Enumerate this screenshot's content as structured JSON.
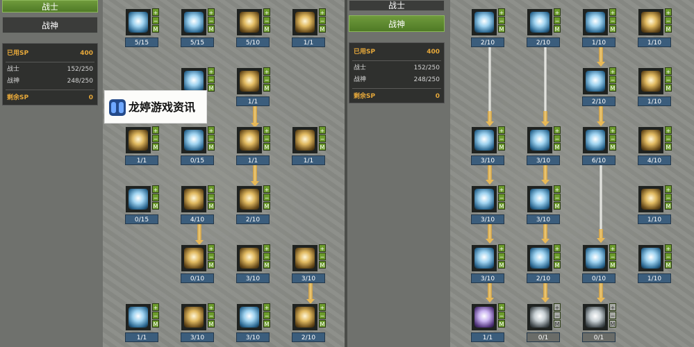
{
  "left": {
    "tab_warrior": "战士",
    "tab_wargod": "战神",
    "sp": {
      "used_label": "已用SP",
      "used_value": "400",
      "class1_label": "战士",
      "class1_value": "152/250",
      "class2_label": "战神",
      "class2_value": "248/250",
      "remain_label": "剩余SP",
      "remain_value": "0"
    },
    "skills": [
      {
        "level": "5/15",
        "icon": "blue"
      },
      {
        "level": "5/15",
        "icon": "blue"
      },
      {
        "level": "5/10",
        "icon": "gold"
      },
      {
        "level": "1/1",
        "icon": "gold"
      },
      {
        "level": "",
        "icon": "blue"
      },
      {
        "level": "1/1",
        "icon": "gold"
      },
      {
        "level": "1/1",
        "icon": "gold"
      },
      {
        "level": "0/15",
        "icon": "blue"
      },
      {
        "level": "1/1",
        "icon": "gold"
      },
      {
        "level": "1/1",
        "icon": "gold"
      },
      {
        "level": "0/15",
        "icon": "blue"
      },
      {
        "level": "4/10",
        "icon": "gold"
      },
      {
        "level": "2/10",
        "icon": "gold"
      },
      {
        "level": "0/10",
        "icon": "gold"
      },
      {
        "level": "3/10",
        "icon": "gold"
      },
      {
        "level": "3/10",
        "icon": "gold"
      },
      {
        "level": "1/1",
        "icon": "blue"
      },
      {
        "level": "3/10",
        "icon": "gold"
      },
      {
        "level": "3/10",
        "icon": "blue"
      },
      {
        "level": "2/10",
        "icon": "gold"
      }
    ]
  },
  "right": {
    "tab_warrior": "战士",
    "tab_wargod": "战神",
    "sp": {
      "used_label": "已用SP",
      "used_value": "400",
      "class1_label": "战士",
      "class1_value": "152/250",
      "class2_label": "战神",
      "class2_value": "248/250",
      "remain_label": "剩余SP",
      "remain_value": "0"
    },
    "skills": [
      {
        "level": "2/10",
        "icon": "blue"
      },
      {
        "level": "2/10",
        "icon": "blue"
      },
      {
        "level": "1/10",
        "icon": "blue"
      },
      {
        "level": "1/10",
        "icon": "gold"
      },
      {
        "level": "2/10",
        "icon": "blue"
      },
      {
        "level": "1/10",
        "icon": "gold"
      },
      {
        "level": "3/10",
        "icon": "blue"
      },
      {
        "level": "3/10",
        "icon": "blue"
      },
      {
        "level": "6/10",
        "icon": "blue"
      },
      {
        "level": "4/10",
        "icon": "gold"
      },
      {
        "level": "3/10",
        "icon": "blue"
      },
      {
        "level": "3/10",
        "icon": "blue"
      },
      {
        "level": "1/10",
        "icon": "gold"
      },
      {
        "level": "3/10",
        "icon": "blue"
      },
      {
        "level": "2/10",
        "icon": "blue"
      },
      {
        "level": "0/10",
        "icon": "blue"
      },
      {
        "level": "1/10",
        "icon": "blue"
      },
      {
        "level": "1/1",
        "icon": "purple"
      },
      {
        "level": "0/1",
        "icon": "grey"
      },
      {
        "level": "0/1",
        "icon": "grey"
      }
    ]
  },
  "buttons": {
    "plus": "+",
    "minus": "−",
    "master": "M"
  },
  "watermark": {
    "text": "龙婷游戏资讯"
  }
}
